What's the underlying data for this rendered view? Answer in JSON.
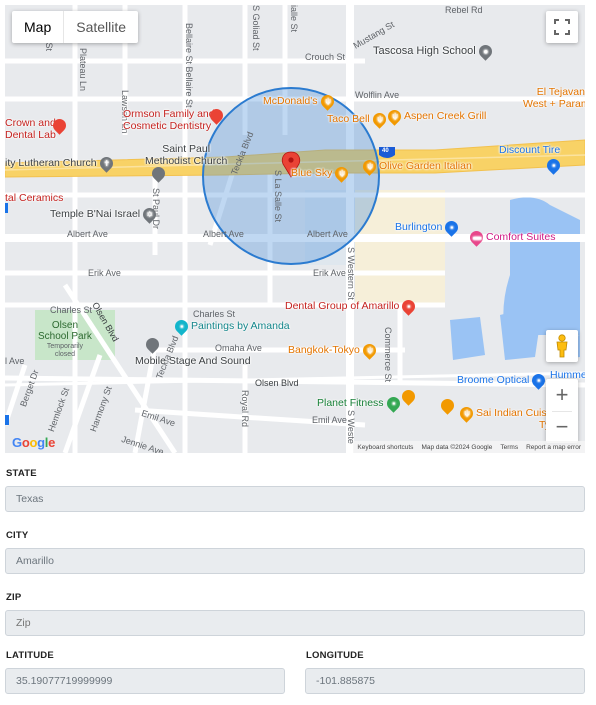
{
  "map": {
    "type_buttons": {
      "map": "Map",
      "satellite": "Satellite"
    },
    "streets": {
      "rebel_rd": "Rebel Rd",
      "mustang_st": "Mustang St",
      "crouch_st": "Crouch St",
      "wolflin_ave": "Wolflin Ave",
      "albert_ave_w": "Albert Ave",
      "albert_ave_c": "Albert Ave",
      "albert_ave_e": "Albert Ave",
      "erik_ave_w": "Erik Ave",
      "erik_ave_e": "Erik Ave",
      "charles_st_w": "Charles St",
      "charles_st_c": "Charles St",
      "omaha_ave": "Omaha Ave",
      "olsen_blvd_c": "Olsen Blvd",
      "olsen_blvd_w": "Olsen Blvd",
      "emil_ave_w": "Emil Ave",
      "emil_ave_e": "Emil Ave",
      "jennie_ave": "Jennie Ave",
      "teckla_blvd_n": "Teckla Blvd",
      "teckla_blvd_s": "Teckla Blvd",
      "s_la_salle_st": "S La Salle St",
      "s_western_st": "S Western St",
      "s_western_st_s": "S Weste",
      "commerce_st": "Commerce St",
      "royal_rd": "Royal Rd",
      "st_paul_dr": "St Paul Dr",
      "bellaire_st": "Bellaire St  Bellaire St",
      "s_goliad_st": "S Goliad St",
      "lawson_ln": "Lawson Ln",
      "plateau_ln": "Plateau Ln",
      "harmony_st": "Harmony St",
      "hemlock_st": "Hemlock St",
      "berget_dr": "Berget Dr",
      "w_ave": "l Ave",
      "le_st": "le St",
      "ialle_st": "ialle St"
    },
    "pois": {
      "tascosa": "Tascosa High School",
      "mcdonalds": "McDonald's",
      "taco_bell": "Taco Bell",
      "aspen_creek": "Aspen Creek Grill",
      "el_tejavan_1": "El Tejavan C",
      "el_tejavan_2": "West + Paramo",
      "ormson_1": "Ormson Family and",
      "ormson_2": "Cosmetic Dentistry",
      "crown_1": "Crown and",
      "crown_2": "Dental Lab",
      "saint_paul_1": "Saint Paul",
      "saint_paul_2": "Methodist Church",
      "lutheran": "ity Lutheran Church",
      "blue_sky": "Blue Sky",
      "olive_garden": "Olive Garden Italian",
      "discount_tire": "Discount Tire",
      "ceramics": "tal Ceramics",
      "temple": "Temple B'Nai Israel",
      "burlington": "Burlington",
      "comfort_suites": "Comfort Suites",
      "dental_group": "Dental Group of Amarillo",
      "paintings": "Paintings by Amanda",
      "olsen_park_1": "Olsen",
      "olsen_park_2": "School Park",
      "olsen_park_3": "Temporarily",
      "olsen_park_4": "closed",
      "mobile_stage": "Mobile Stage And Sound",
      "bangkok": "Bangkok-Tokyo",
      "broome": "Broome Optical",
      "hummers": "Hummers",
      "planet_fitness": "Planet Fitness",
      "sai_indian": "Sai Indian Cuisine",
      "tylers": "Tyler's",
      "highway_shield": "40"
    },
    "controls": {
      "zoom_in": "+",
      "zoom_out": "−"
    },
    "logo": [
      "G",
      "o",
      "o",
      "g",
      "l",
      "e"
    ],
    "attribution": {
      "shortcuts": "Keyboard shortcuts",
      "data": "Map data ©2024 Google",
      "terms": "Terms",
      "report": "Report a map error"
    }
  },
  "form": {
    "state": {
      "label": "STATE",
      "value": "Texas"
    },
    "city": {
      "label": "CITY",
      "value": "Amarillo"
    },
    "zip": {
      "label": "ZIP",
      "placeholder": "Zip"
    },
    "latitude": {
      "label": "LATITUDE",
      "value": "35.19077719999999"
    },
    "longitude": {
      "label": "LONGITUDE",
      "value": "-101.885875"
    }
  },
  "colors": {
    "map_bg": "#e8eaed",
    "highway": "#f8d266",
    "water": "#9ac3f4",
    "park": "#c8e6c9",
    "radius_fill": "#4a90d9",
    "field_bg": "#e9ecef"
  }
}
